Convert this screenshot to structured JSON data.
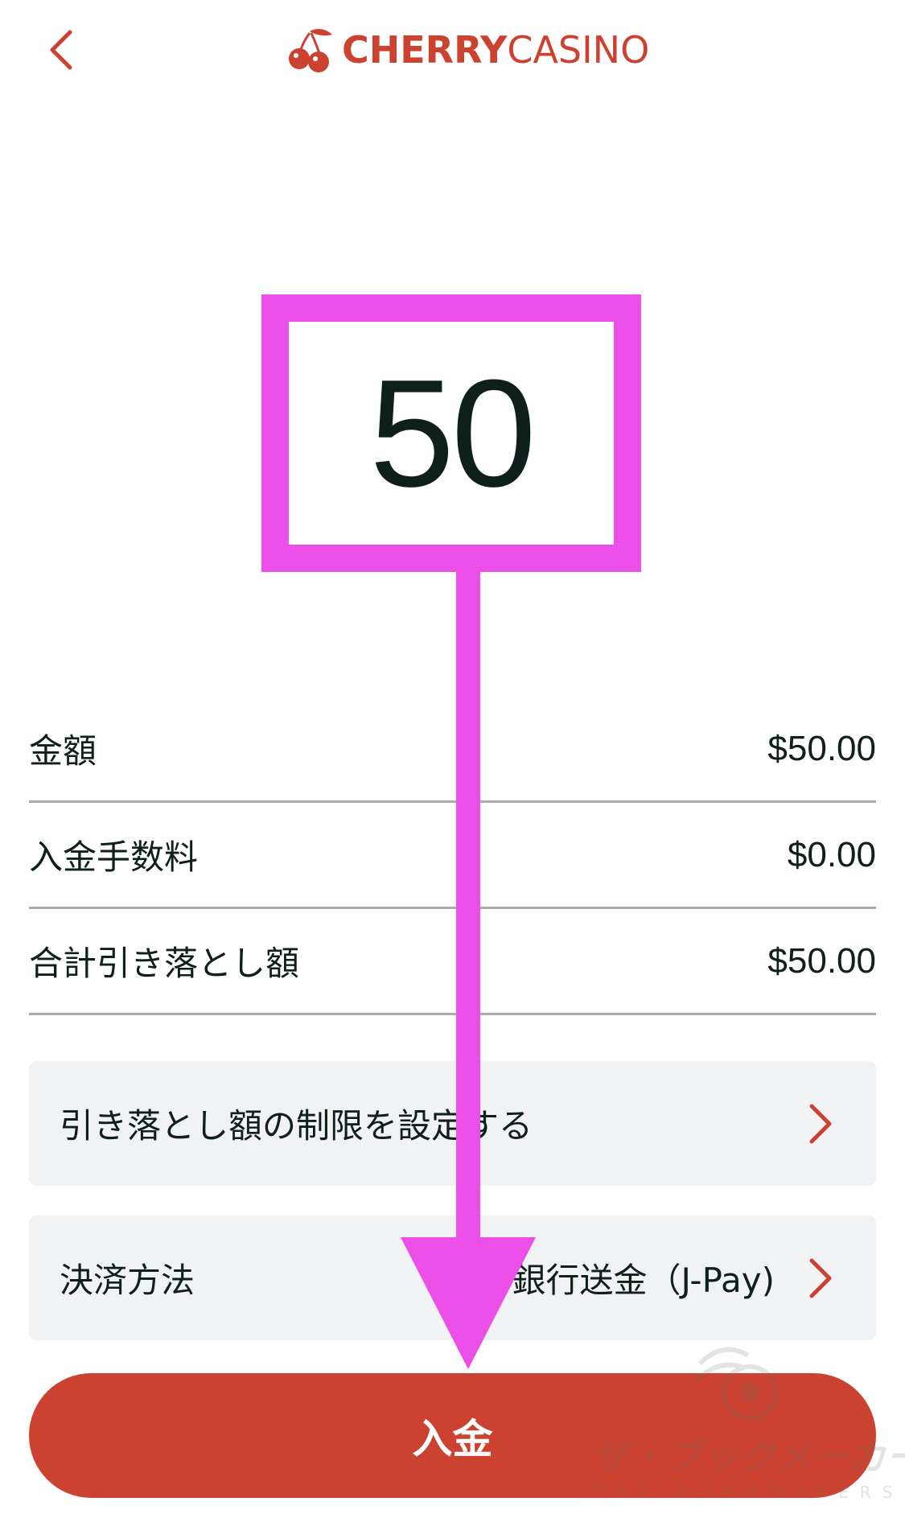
{
  "header": {
    "back_icon": "chevron-left-icon",
    "logo": {
      "bold": "CHERRY",
      "light": "CASINO",
      "icon": "cherry-icon"
    }
  },
  "amount_input": {
    "value": "50"
  },
  "summary": [
    {
      "label": "金額",
      "value": "$50.00"
    },
    {
      "label": "入金手数料",
      "value": "$0.00"
    },
    {
      "label": "合計引き落とし額",
      "value": "$50.00"
    }
  ],
  "options": {
    "limit": {
      "label": "引き落とし額の制限を設定する",
      "icon": "chevron-right-icon"
    },
    "payment": {
      "label": "決済方法",
      "value": "銀行送金（J-Pay)",
      "icon": "chevron-right-icon"
    }
  },
  "deposit_button": {
    "label": "入金"
  },
  "watermark": {
    "text": "ザ・ブックメーカーズ",
    "sub": "THE BOOKMAKERS"
  },
  "colors": {
    "brand": "#cb4330",
    "annotation": "#ec4ee8",
    "row_bg": "#f1f2f3",
    "divider": "#a8adac",
    "text": "#0f1f1c"
  }
}
